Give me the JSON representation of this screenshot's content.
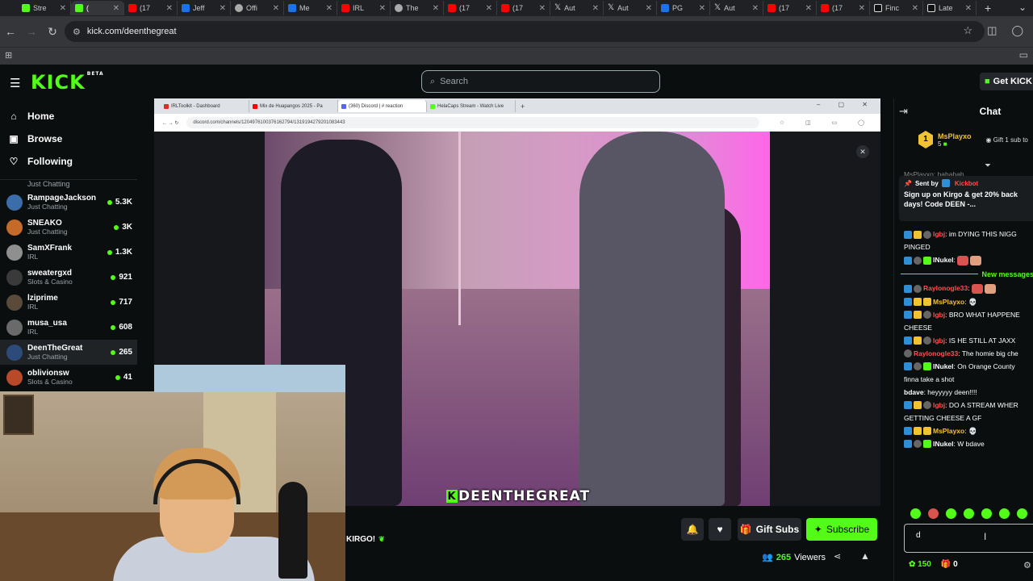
{
  "browser": {
    "tabs": [
      {
        "label": "Stre",
        "icon": "kick-icon",
        "color": "green"
      },
      {
        "label": "(",
        "icon": "kick-icon",
        "color": "green",
        "active": true
      },
      {
        "label": "(17",
        "icon": "youtube-icon",
        "color": "red"
      },
      {
        "label": "Jeff",
        "icon": "tab-icon",
        "color": "blue"
      },
      {
        "label": "Offi",
        "icon": "tab-icon",
        "color": "gray"
      },
      {
        "label": "Me",
        "icon": "tab-icon",
        "color": "blue"
      },
      {
        "label": "IRL",
        "icon": "tab-icon",
        "color": "red"
      },
      {
        "label": "The",
        "icon": "tab-icon",
        "color": "gray"
      },
      {
        "label": "(17",
        "icon": "youtube-icon",
        "color": "red"
      },
      {
        "label": "(17",
        "icon": "youtube-icon",
        "color": "red"
      },
      {
        "label": "Aut",
        "icon": "x-icon",
        "color": "x"
      },
      {
        "label": "Aut",
        "icon": "x-icon",
        "color": "x"
      },
      {
        "label": "PG",
        "icon": "tab-icon",
        "color": "blue"
      },
      {
        "label": "Aut",
        "icon": "x-icon",
        "color": "x"
      },
      {
        "label": "(17",
        "icon": "youtube-icon",
        "color": "red"
      },
      {
        "label": "(17",
        "icon": "youtube-icon",
        "color": "red"
      },
      {
        "label": "Finc",
        "icon": "tiktok-icon",
        "color": "tt"
      },
      {
        "label": "Late",
        "icon": "tiktok-icon",
        "color": "tt"
      }
    ],
    "url": "kick.com/deenthegreat"
  },
  "header": {
    "logo": "KICK",
    "logo_tag": "BETA",
    "search_placeholder": "Search",
    "get_kick": "Get KICK"
  },
  "sidebar": {
    "nav": [
      {
        "label": "Home",
        "icon": "home-icon",
        "glyph": "⌂"
      },
      {
        "label": "Browse",
        "icon": "browse-icon",
        "glyph": "▣"
      },
      {
        "label": "Following",
        "icon": "heart-icon",
        "glyph": "♡"
      }
    ],
    "top_category": "Just Chatting",
    "channels": [
      {
        "name": "RampageJackson",
        "category": "Just Chatting",
        "viewers": "5.3K",
        "color": "#3b6ea8"
      },
      {
        "name": "SNEAKO",
        "category": "Just Chatting",
        "viewers": "3K",
        "color": "#c56b2a"
      },
      {
        "name": "SamXFrank",
        "category": "IRL",
        "viewers": "1.3K",
        "color": "#8f8f8f"
      },
      {
        "name": "sweatergxd",
        "category": "Slots & Casino",
        "viewers": "921",
        "color": "#3a3a3a"
      },
      {
        "name": "lziprime",
        "category": "IRL",
        "viewers": "717",
        "color": "#5a4a3a"
      },
      {
        "name": "musa_usa",
        "category": "IRL",
        "viewers": "608",
        "color": "#6a6a6a"
      },
      {
        "name": "DeenTheGreat",
        "category": "Just Chatting",
        "viewers": "265",
        "color": "#2d4b7a",
        "active": true
      },
      {
        "name": "oblivionsw",
        "category": "Slots & Casino",
        "viewers": "41",
        "color": "#b84a2a"
      }
    ]
  },
  "stream": {
    "inner_tabs": [
      "IRLToolkit - Dashboard",
      "Mix de Huapangos 2025 - Pa",
      "(360) Discord | # reaction",
      "HelaCaps Stream - Watch Live"
    ],
    "inner_url": "discord.com/channels/1204976100376162794/1319194279201083443",
    "watermark": "DEENTHEGREAT",
    "below_text": "KIRGO!",
    "gift_subs": "Gift Subs",
    "subscribe": "Subscribe",
    "viewer_count": "265",
    "viewers_label": "Viewers"
  },
  "chat": {
    "title": "Chat",
    "pinned": {
      "rank": "1",
      "name": "MsPlayxo",
      "count": "5",
      "gift_text": "Gift 1 sub to"
    },
    "partial_top": "MsPlayxo: hahahah",
    "promo": {
      "sent_by": "Sent by",
      "sender": "Kickbot",
      "line1": "Sign up on Kirgo & get 20% back",
      "line2": "days! Code DEEN -..."
    },
    "messages": [
      {
        "user": "lgbj",
        "color": "#ff5050",
        "text": ": im DYING THIS NIGG",
        "badges": [
          "blue",
          "gold",
          "gray"
        ]
      },
      {
        "user": "",
        "color": "",
        "text": "PINGED",
        "badges": []
      },
      {
        "user": "lNukel",
        "color": "#ffffff",
        "text": ":",
        "badges": [
          "blue",
          "gray",
          "green"
        ],
        "emoji": true
      },
      {
        "divider": "New messages"
      },
      {
        "user": "Raylonogle33",
        "color": "#ff5050",
        "text": ":",
        "badges": [
          "blue",
          "gray"
        ],
        "emoji": true
      },
      {
        "user": "MsPlayxo",
        "color": "#f1c232",
        "text": ": 💀",
        "badges": [
          "blue",
          "gold",
          "gold"
        ]
      },
      {
        "user": "lgbj",
        "color": "#ff5050",
        "text": ": BRO WHAT HAPPENE",
        "badges": [
          "blue",
          "gold",
          "gray"
        ]
      },
      {
        "user": "",
        "color": "",
        "text": "CHEESE",
        "badges": []
      },
      {
        "user": "lgbj",
        "color": "#ff5050",
        "text": ": IS HE STILL AT JAXX",
        "badges": [
          "blue",
          "gold",
          "gray"
        ]
      },
      {
        "user": "Raylonogle33",
        "color": "#ff5050",
        "text": ": The homie big che",
        "badges": [
          "gray"
        ]
      },
      {
        "user": "lNukel",
        "color": "#ffffff",
        "text": ": On Orange County",
        "badges": [
          "blue",
          "gray",
          "green"
        ]
      },
      {
        "user": "",
        "color": "",
        "text": "finna take a shot",
        "badges": []
      },
      {
        "user": "bdave",
        "color": "#ffffff",
        "text": ": heyyyyy deen!!!!",
        "badges": []
      },
      {
        "user": "lgbj",
        "color": "#ff5050",
        "text": ": DO A STREAM WHER",
        "badges": [
          "blue",
          "gold",
          "gray"
        ]
      },
      {
        "user": "",
        "color": "",
        "text": "GETTING CHEESE A GF",
        "badges": []
      },
      {
        "user": "MsPlayxo",
        "color": "#f1c232",
        "text": ": 💀",
        "badges": [
          "blue",
          "gold",
          "gold"
        ]
      },
      {
        "user": "lNukel",
        "color": "#ffffff",
        "text": ": W bdave",
        "badges": [
          "blue",
          "gray",
          "green"
        ]
      }
    ],
    "input_value": "d",
    "points": "150",
    "gifts": "0"
  },
  "colors": {
    "kick_green": "#53fc18",
    "bg": "#0b0e0f"
  }
}
